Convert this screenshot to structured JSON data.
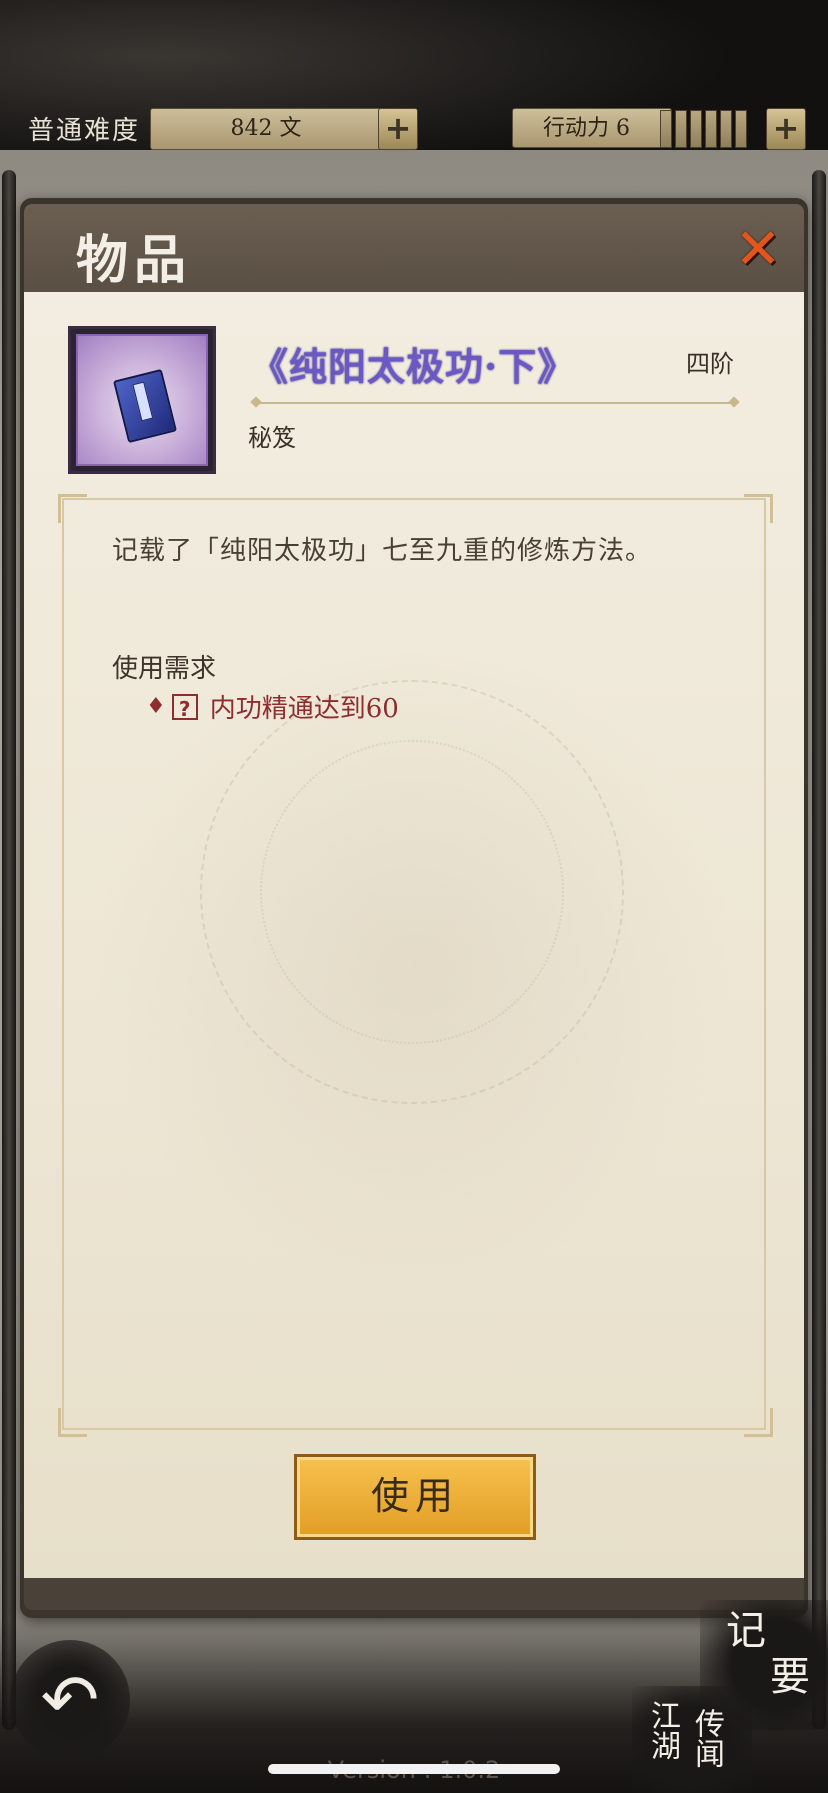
{
  "header": {
    "difficulty_label": "普通难度",
    "money_value": "842 文",
    "action_label": "行动力 6",
    "add_money_label": "+",
    "add_action_label": "+"
  },
  "panel": {
    "title": "物品",
    "close_label": "✕"
  },
  "item": {
    "icon": "book-icon",
    "name": "《纯阳太极功·下》",
    "rank": "四阶",
    "type": "秘笈",
    "description": "记载了「纯阳太极功」七至九重的修炼方法。",
    "requirements_title": "使用需求",
    "requirements": [
      {
        "bullet": "♦",
        "icon_label": "?",
        "text": "内功精通达到60"
      }
    ]
  },
  "actions": {
    "use_label": "使用"
  },
  "bottom": {
    "back_label": "↶",
    "jiyao_char1": "记",
    "jiyao_char2": "要",
    "jianghu_col1": "江湖",
    "jianghu_col2": "传闻",
    "version": "Version : 1.0.2"
  },
  "colors": {
    "item_name": "#6b58c7",
    "requirement": "#8e2d2d",
    "use_button": "#f0b23c",
    "close_button": "#e0561c"
  }
}
